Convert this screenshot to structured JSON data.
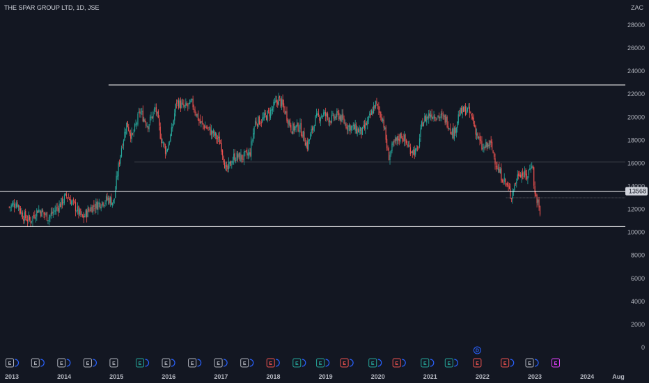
{
  "header": {
    "title": "THE SPAR GROUP LTD, 1D, JSE",
    "currency": "ZAC"
  },
  "price_label": "13568",
  "colors": {
    "background": "#131722",
    "up": "#26a69a",
    "down": "#ef5350",
    "lines": "#ffffff"
  },
  "chart_data": {
    "type": "candlestick",
    "title": "THE SPAR GROUP LTD, 1D, JSE",
    "ylim": [
      0,
      29000
    ],
    "y_ticks": [
      "0",
      "2000",
      "4000",
      "6000",
      "8000",
      "10000",
      "12000",
      "14000",
      "16000",
      "18000",
      "20000",
      "22000",
      "24000",
      "26000",
      "28000"
    ],
    "x_ticks": [
      "2013",
      "2014",
      "2015",
      "2016",
      "2017",
      "2018",
      "2019",
      "2020",
      "2021",
      "2022",
      "2023",
      "2024",
      "Aug"
    ],
    "price_path": [
      [
        2012.95,
        12200
      ],
      [
        2013.1,
        12600
      ],
      [
        2013.2,
        11500
      ],
      [
        2013.35,
        11000
      ],
      [
        2013.5,
        12000
      ],
      [
        2013.7,
        11300
      ],
      [
        2013.9,
        12300
      ],
      [
        2014.05,
        13200
      ],
      [
        2014.2,
        12300
      ],
      [
        2014.35,
        11200
      ],
      [
        2014.5,
        12100
      ],
      [
        2014.7,
        12600
      ],
      [
        2014.85,
        12900
      ],
      [
        2014.95,
        12600
      ],
      [
        2015.0,
        14500
      ],
      [
        2015.1,
        17500
      ],
      [
        2015.2,
        19500
      ],
      [
        2015.3,
        18200
      ],
      [
        2015.45,
        20500
      ],
      [
        2015.6,
        19300
      ],
      [
        2015.75,
        20800
      ],
      [
        2015.85,
        18200
      ],
      [
        2015.95,
        17000
      ],
      [
        2016.05,
        18600
      ],
      [
        2016.15,
        21400
      ],
      [
        2016.3,
        20800
      ],
      [
        2016.45,
        21200
      ],
      [
        2016.6,
        19500
      ],
      [
        2016.75,
        19000
      ],
      [
        2016.9,
        18300
      ],
      [
        2017.0,
        17700
      ],
      [
        2017.1,
        15200
      ],
      [
        2017.25,
        16600
      ],
      [
        2017.4,
        16500
      ],
      [
        2017.55,
        16800
      ],
      [
        2017.65,
        19600
      ],
      [
        2017.8,
        19800
      ],
      [
        2017.95,
        20500
      ],
      [
        2018.1,
        21600
      ],
      [
        2018.2,
        20800
      ],
      [
        2018.35,
        19000
      ],
      [
        2018.5,
        19200
      ],
      [
        2018.65,
        17500
      ],
      [
        2018.8,
        19800
      ],
      [
        2018.95,
        20300
      ],
      [
        2019.1,
        19800
      ],
      [
        2019.25,
        20200
      ],
      [
        2019.4,
        19300
      ],
      [
        2019.55,
        19000
      ],
      [
        2019.7,
        18700
      ],
      [
        2019.85,
        20000
      ],
      [
        2019.95,
        21200
      ],
      [
        2020.1,
        19800
      ],
      [
        2020.2,
        16500
      ],
      [
        2020.3,
        17600
      ],
      [
        2020.45,
        18500
      ],
      [
        2020.6,
        17300
      ],
      [
        2020.75,
        16900
      ],
      [
        2020.85,
        19600
      ],
      [
        2021.0,
        20300
      ],
      [
        2021.15,
        20100
      ],
      [
        2021.3,
        19800
      ],
      [
        2021.45,
        18500
      ],
      [
        2021.55,
        20300
      ],
      [
        2021.7,
        20700
      ],
      [
        2021.8,
        20000
      ],
      [
        2021.9,
        18400
      ],
      [
        2022.0,
        17200
      ],
      [
        2022.15,
        17700
      ],
      [
        2022.3,
        15400
      ],
      [
        2022.45,
        14200
      ],
      [
        2022.55,
        13200
      ],
      [
        2022.7,
        15300
      ],
      [
        2022.85,
        14800
      ],
      [
        2022.95,
        16200
      ],
      [
        2023.0,
        13300
      ],
      [
        2023.05,
        12800
      ],
      [
        2023.1,
        11500
      ]
    ],
    "horizontal_lines": [
      {
        "value": 22800,
        "from": 2014.85,
        "to": 2024.4,
        "style": "solid"
      },
      {
        "value": 16100,
        "from": 2015.35,
        "to": 2024.4,
        "style": "dotted"
      },
      {
        "value": 13568,
        "from": 2012.92,
        "to": 2024.4,
        "style": "solid"
      },
      {
        "value": 10500,
        "from": 2012.92,
        "to": 2024.4,
        "style": "solid"
      },
      {
        "value": 13000,
        "from": 2022.45,
        "to": 2024.15,
        "style": "dotted"
      }
    ],
    "events": [
      {
        "x": 2012.98,
        "type": "E",
        "color": "#b2b5be",
        "dot": "#2962ff"
      },
      {
        "x": 2013.47,
        "type": "E",
        "color": "#b2b5be",
        "dot": "#2962ff"
      },
      {
        "x": 2013.97,
        "type": "E",
        "color": "#b2b5be",
        "dot": "#2962ff"
      },
      {
        "x": 2014.47,
        "type": "E",
        "color": "#b2b5be",
        "dot": "#2962ff"
      },
      {
        "x": 2014.97,
        "type": "E",
        "color": "#b2b5be",
        "dot": ""
      },
      {
        "x": 2015.47,
        "type": "E",
        "color": "#26a69a",
        "dot": "#2962ff"
      },
      {
        "x": 2015.97,
        "type": "E",
        "color": "#b2b5be",
        "dot": "#2962ff"
      },
      {
        "x": 2016.47,
        "type": "E",
        "color": "#b2b5be",
        "dot": "#2962ff"
      },
      {
        "x": 2016.97,
        "type": "E",
        "color": "#b2b5be",
        "dot": "#2962ff"
      },
      {
        "x": 2017.47,
        "type": "E",
        "color": "#b2b5be",
        "dot": "#2962ff"
      },
      {
        "x": 2017.97,
        "type": "E",
        "color": "#ef5350",
        "dot": "#2962ff"
      },
      {
        "x": 2018.47,
        "type": "E",
        "color": "#26a69a",
        "dot": "#2962ff"
      },
      {
        "x": 2018.92,
        "type": "E",
        "color": "#26a69a",
        "dot": "#2962ff"
      },
      {
        "x": 2019.38,
        "type": "E",
        "color": "#ef5350",
        "dot": "#2962ff"
      },
      {
        "x": 2019.92,
        "type": "E",
        "color": "#26a69a",
        "dot": "#2962ff"
      },
      {
        "x": 2020.38,
        "type": "E",
        "color": "#ef5350",
        "dot": "#2962ff"
      },
      {
        "x": 2020.92,
        "type": "E",
        "color": "#26a69a",
        "dot": "#2962ff"
      },
      {
        "x": 2021.38,
        "type": "E",
        "color": "#26a69a",
        "dot": "#2962ff"
      },
      {
        "x": 2021.92,
        "type": "E",
        "color": "#ef5350",
        "dot": "",
        "dividend": "D"
      },
      {
        "x": 2022.45,
        "type": "E",
        "color": "#ef5350",
        "dot": "#2962ff"
      },
      {
        "x": 2022.92,
        "type": "E",
        "color": "#b2b5be",
        "dot": "#2962ff"
      },
      {
        "x": 2023.42,
        "type": "E",
        "color": "#e040fb",
        "dot": ""
      }
    ]
  }
}
